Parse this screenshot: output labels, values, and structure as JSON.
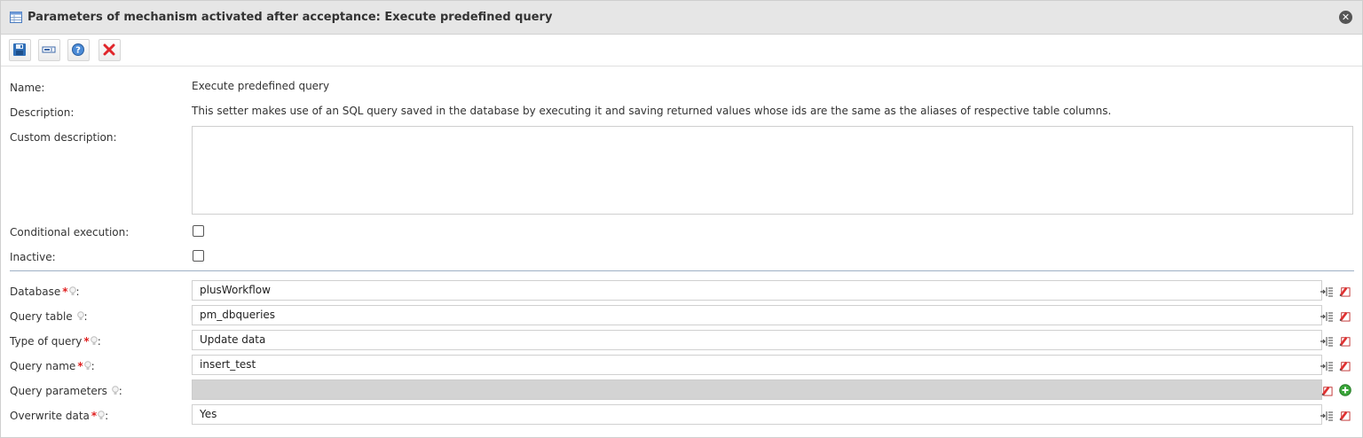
{
  "dialog": {
    "title": "Parameters of mechanism activated after acceptance: Execute predefined query"
  },
  "toolbar": {
    "buttons": [
      {
        "name": "save",
        "icon": "floppy-disk-icon"
      },
      {
        "name": "form",
        "icon": "form-field-icon"
      },
      {
        "name": "help",
        "icon": "help-icon"
      },
      {
        "name": "cancel",
        "icon": "red-x-icon"
      }
    ]
  },
  "info": {
    "name_label": "Name:",
    "name_value": "Execute predefined query",
    "description_label": "Description:",
    "description_value": "This setter makes use of an SQL query saved in the database by executing it and saving returned values whose ids are the same as the aliases of respective table columns.",
    "custom_description_label": "Custom description:",
    "custom_description_value": "",
    "conditional_label": "Conditional execution:",
    "conditional_checked": false,
    "inactive_label": "Inactive:",
    "inactive_checked": false
  },
  "params": {
    "database": {
      "label": "Database",
      "required": true,
      "value": "plusWorkflow"
    },
    "query_table": {
      "label": "Query table",
      "required": false,
      "value": "pm_dbqueries"
    },
    "query_type": {
      "label": "Type of query",
      "required": true,
      "value": "Update data"
    },
    "query_name": {
      "label": "Query name",
      "required": true,
      "value": "insert_test"
    },
    "query_params": {
      "label": "Query parameters",
      "required": false,
      "value": ""
    },
    "overwrite": {
      "label": "Overwrite data",
      "required": true,
      "value": "Yes"
    }
  },
  "colon": ":",
  "required_mark": "*",
  "colors": {
    "titlebar_bg": "#e6e6e6",
    "required": "#e02020",
    "separator": "#9fb0c4",
    "disabled_field": "#d3d3d3"
  }
}
